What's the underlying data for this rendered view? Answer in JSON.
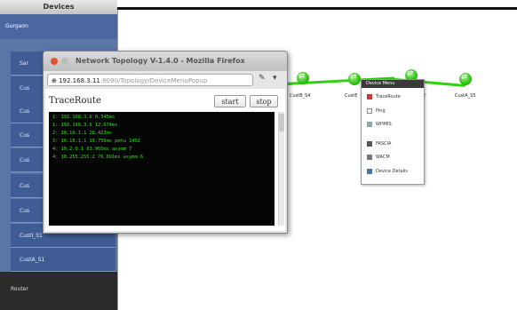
{
  "sidebar": {
    "header": "Devices",
    "section": "Gurgaon",
    "items": [
      {
        "label": "Sar"
      },
      {
        "label": "Cus"
      },
      {
        "label": "Cus"
      },
      {
        "label": "Cus"
      },
      {
        "label": "Cus"
      },
      {
        "label": "Cus"
      },
      {
        "label": "Cus"
      },
      {
        "label": "CustI_S1"
      },
      {
        "label": "CustA_S1"
      }
    ],
    "router": "Router"
  },
  "topology": {
    "node_labels": [
      "CustB_S4",
      "CustE",
      "CustA_S5"
    ],
    "node_label_2": "2",
    "link_color": "#34d016"
  },
  "context_menu": {
    "title": "Device Menu",
    "items": [
      {
        "label": "TraceRoute",
        "icon": "traceroute-icon"
      },
      {
        "label": "Ping",
        "icon": "ping-icon"
      },
      {
        "label": "WHMIS",
        "icon": "whmis-icon"
      },
      {
        "label": "FASCIA",
        "icon": "fascia-icon"
      },
      {
        "label": "WACM",
        "icon": "wacm-icon"
      },
      {
        "label": "Device Details",
        "icon": "device-details-icon"
      }
    ]
  },
  "browser": {
    "title": "Network Topology V-1.4.0 - Mozilla Firefox",
    "url_host": "192.168.3.11",
    "url_path": ":9090/Topology/DeviceMenuPopup",
    "content": {
      "heading": "TraceRoute",
      "start_label": "start",
      "stop_label": "stop",
      "output": [
        "1: 192.168.3.6 0.345ms",
        "1: 192.168.3.6 12.674ms",
        "2: 10.10.1.1 28.423ms",
        "3: 10.10.1.1 19.756ms pmtu 1492",
        "4: 10.2.0.1 63.965ms asymm 7",
        "4: 10.255.255.2 76.891ms asymm 6"
      ]
    }
  },
  "colors": {
    "sidebar_bg": "#5a76a6",
    "terminal_bg": "#050505",
    "terminal_text": "#35e11b",
    "close_button": "#e2522f"
  }
}
